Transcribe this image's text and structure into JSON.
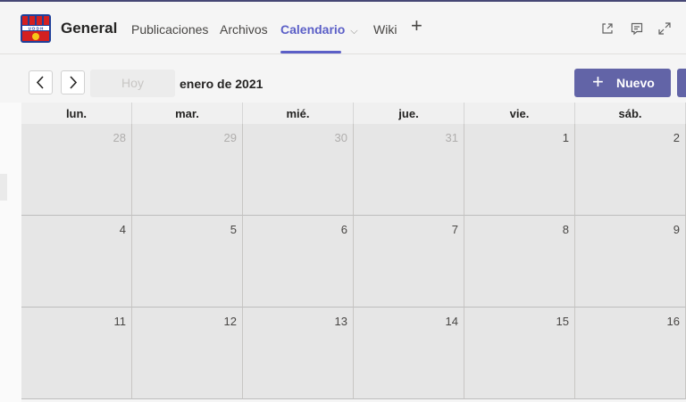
{
  "header": {
    "team_name": "General",
    "tabs": [
      {
        "label": "Publicaciones"
      },
      {
        "label": "Archivos"
      },
      {
        "label": "Calendario"
      },
      {
        "label": "Wiki"
      }
    ],
    "active_tab_chevron": "⌵",
    "add_tab_glyph": "+",
    "logo_text": "U D D H"
  },
  "toolbar": {
    "prev_glyph": "‹",
    "next_glyph": "›",
    "today_label": "Hoy",
    "month_label": "enero de 2021",
    "new_label": "Nuevo",
    "new_glyph": "+"
  },
  "calendar": {
    "day_headers": [
      "lun.",
      "mar.",
      "mié.",
      "jue.",
      "vie.",
      "sáb."
    ],
    "weeks": [
      [
        "28",
        "29",
        "30",
        "31",
        "1",
        "2"
      ],
      [
        "4",
        "5",
        "6",
        "7",
        "8",
        "9"
      ],
      [
        "11",
        "12",
        "13",
        "14",
        "15",
        "16"
      ]
    ]
  },
  "colors": {
    "accent": "#6264a7",
    "active_tab": "#5b5fc7",
    "cell_bg": "#e6e6e6"
  }
}
